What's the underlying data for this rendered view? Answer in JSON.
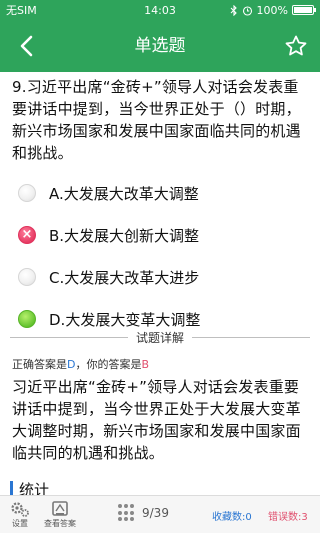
{
  "status_bar": {
    "carrier": "无SIM",
    "time": "14:03",
    "battery": "100%"
  },
  "header": {
    "title": "单选题"
  },
  "question": {
    "text": "9.习近平出席“金砖+”领导人对话会发表重要讲话中提到，当今世界正处于（）时期，新兴市场国家和发展中国家面临共同的机遇和挑战。"
  },
  "options": [
    {
      "label": "A.大发展大改革大调整",
      "state": "neutral"
    },
    {
      "label": "B.大发展大创新大调整",
      "state": "wrong",
      "mark": "×"
    },
    {
      "label": "C.大发展大改革大进步",
      "state": "neutral"
    },
    {
      "label": "D.大发展大变革大调整",
      "state": "correct"
    }
  ],
  "details": {
    "divider_title": "试题详解",
    "correct_prefix": "正确答案是",
    "correct_answer": "D",
    "your_prefix": "，你的答案是",
    "your_answer": "B",
    "explanation": "习近平出席“金砖+”领导人对话会发表重要讲话中提到，当今世界正处于大发展大变革大调整时期，新兴市场国家和发展中国家面临共同的机遇和挑战。",
    "stats_title": "统计"
  },
  "bottom_bar": {
    "settings_label": "设置",
    "view_answer_label": "查看答案",
    "progress": "9/39",
    "favorites": "收藏数:0",
    "errors": "错误数:3"
  },
  "colors": {
    "accent": "#2ea45b",
    "wrong": "#e63b63",
    "correct": "#5fc02c",
    "link_blue": "#2a76d2"
  }
}
